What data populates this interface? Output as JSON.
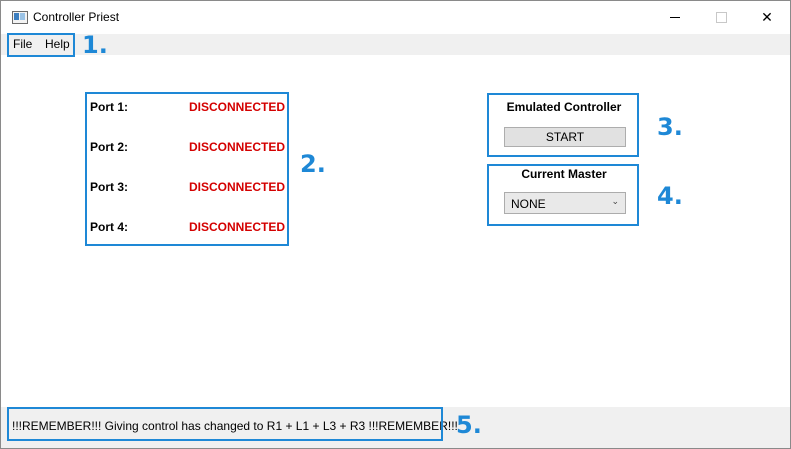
{
  "window": {
    "title": "Controller Priest",
    "controls": {
      "minimize": "minimize-icon",
      "maximize": "maximize-icon",
      "close": "✕"
    }
  },
  "menu": {
    "file": "File",
    "help": "Help"
  },
  "ports": [
    {
      "label": "Port 1:",
      "status": "DISCONNECTED"
    },
    {
      "label": "Port 2:",
      "status": "DISCONNECTED"
    },
    {
      "label": "Port 3:",
      "status": "DISCONNECTED"
    },
    {
      "label": "Port 4:",
      "status": "DISCONNECTED"
    }
  ],
  "emulated_controller": {
    "title": "Emulated Controller",
    "button": "START"
  },
  "current_master": {
    "title": "Current Master",
    "selected": "NONE"
  },
  "status": {
    "message": "!!!REMEMBER!!! Giving control has changed to R1 + L1 + L3 + R3 !!!REMEMBER!!!"
  },
  "annotations": {
    "n1": "1.",
    "n2": "2.",
    "n3": "3.",
    "n4": "4.",
    "n5": "5."
  },
  "colors": {
    "annotation": "#1e88d6",
    "status_disconnected": "#d40000"
  }
}
